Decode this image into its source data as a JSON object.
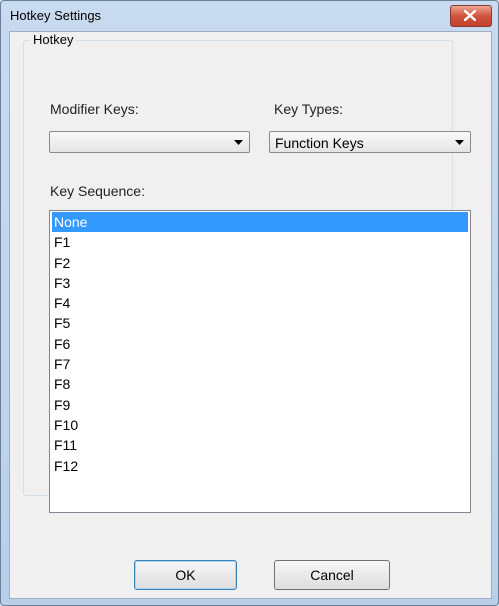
{
  "window": {
    "title": "Hotkey Settings"
  },
  "hotkey_group": {
    "legend": "Hotkey",
    "modifier_label": "Modifier Keys:",
    "modifier_value": "",
    "key_types_label": "Key Types:",
    "key_types_value": "Function Keys",
    "sequence_label": "Key Sequence:",
    "sequence_items": [
      "None",
      "F1",
      "F2",
      "F3",
      "F4",
      "F5",
      "F6",
      "F7",
      "F8",
      "F9",
      "F10",
      "F11",
      "F12"
    ],
    "selected_index": 0
  },
  "buttons": {
    "ok": "OK",
    "cancel": "Cancel"
  }
}
